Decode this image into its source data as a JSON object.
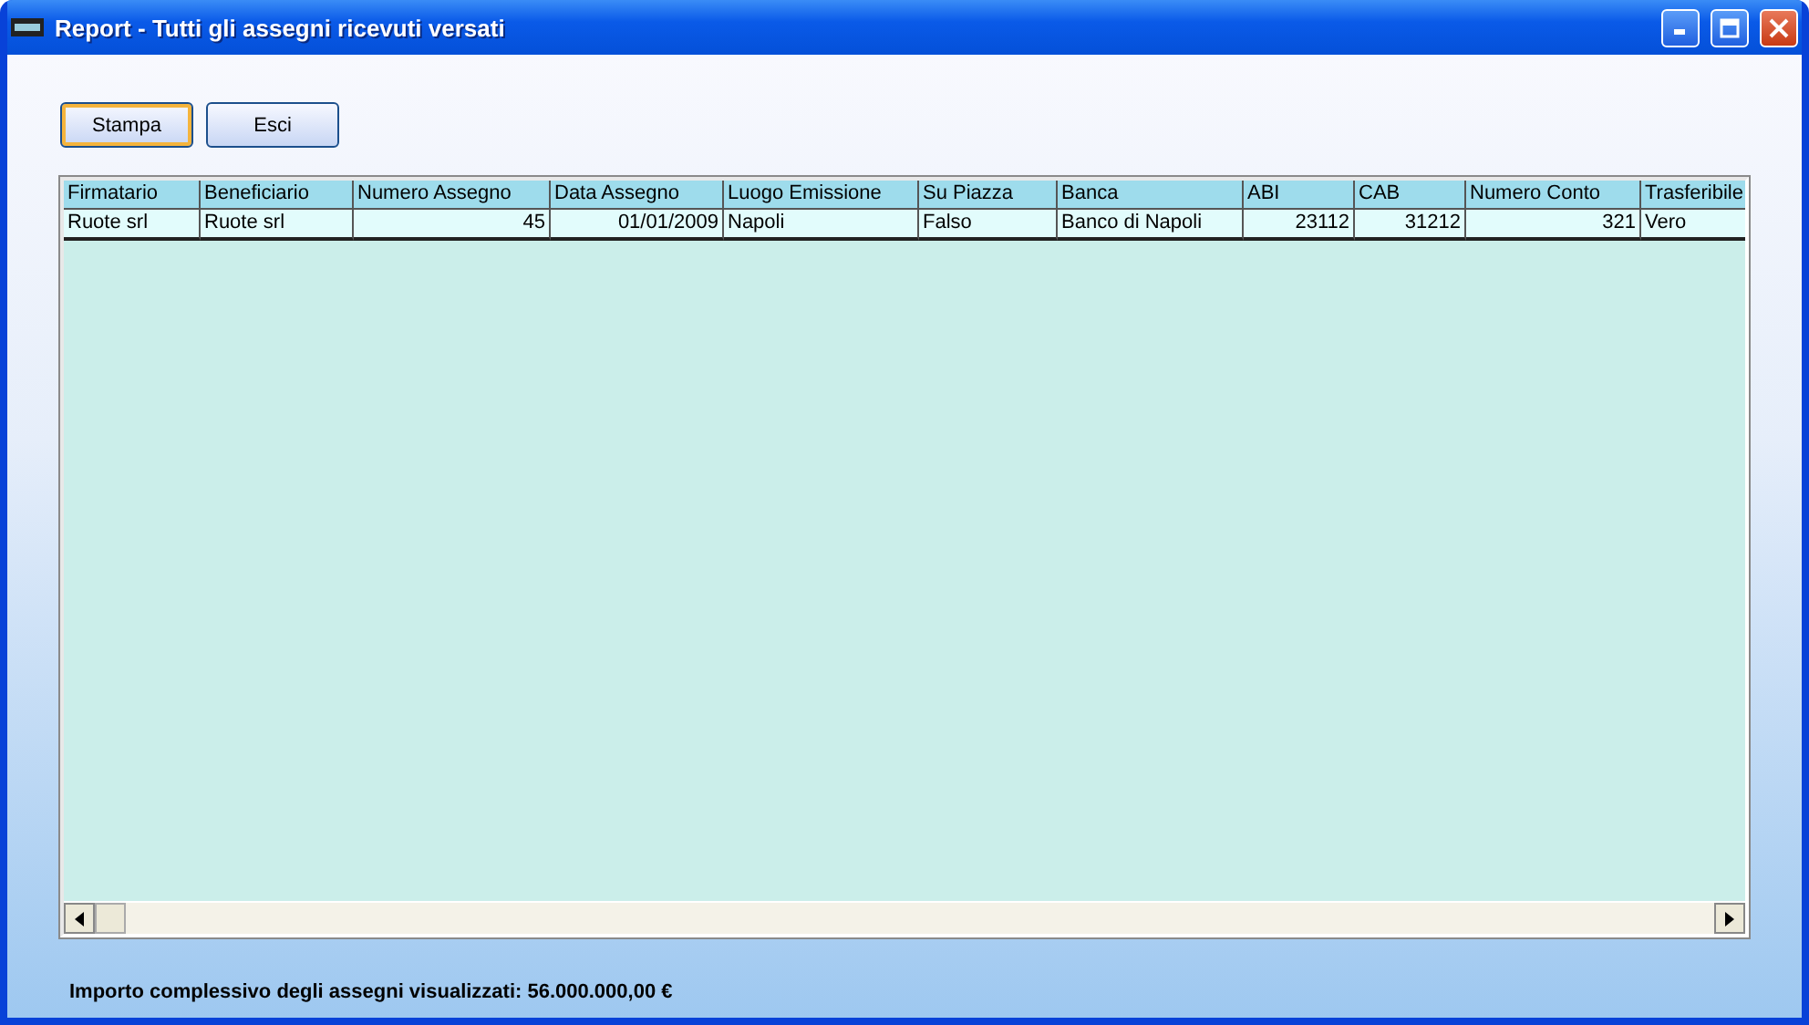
{
  "window": {
    "title": "Report - Tutti gli assegni ricevuti versati"
  },
  "buttons": [
    {
      "label": "Stampa",
      "selected": true
    },
    {
      "label": "Esci",
      "selected": false
    }
  ],
  "table": {
    "columns": [
      {
        "label": "Firmatario",
        "kind": "text"
      },
      {
        "label": "Beneficiario",
        "kind": "text"
      },
      {
        "label": "Numero Assegno",
        "kind": "number"
      },
      {
        "label": "Data Assegno",
        "kind": "number"
      },
      {
        "label": "Luogo Emissione",
        "kind": "text"
      },
      {
        "label": "Su Piazza",
        "kind": "text"
      },
      {
        "label": "Banca",
        "kind": "text"
      },
      {
        "label": "ABI",
        "kind": "number"
      },
      {
        "label": "CAB",
        "kind": "number"
      },
      {
        "label": "Numero Conto",
        "kind": "number"
      },
      {
        "label": "Trasferibile",
        "kind": "text"
      }
    ],
    "rows": [
      [
        "Ruote srl",
        "Ruote srl",
        "45",
        "01/01/2009",
        "Napoli",
        "Falso",
        "Banco di Napoli",
        "23112",
        "31212",
        "321",
        "Vero"
      ]
    ]
  },
  "footer": "Importo complessivo degli assegni visualizzati: 56.000.000,00 €"
}
